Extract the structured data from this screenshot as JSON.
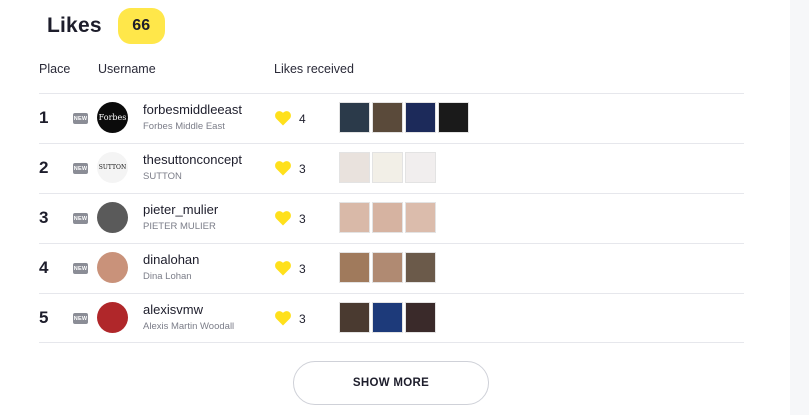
{
  "title": "Likes",
  "total_count": "66",
  "columns": {
    "place": "Place",
    "username": "Username",
    "likes_received": "Likes received"
  },
  "new_tag": "NEW",
  "rows": [
    {
      "place": "1",
      "username": "forbesmiddleeast",
      "full_name": "Forbes Middle East",
      "likes": "4",
      "avatar_text": "Forbes",
      "avatar_color": "#0b0b0b",
      "thumb_colors": [
        "#2b3a4a",
        "#5a4a3a",
        "#1c2a5a",
        "#1a1a1a"
      ]
    },
    {
      "place": "2",
      "username": "thesuttonconcept",
      "full_name": "SUTTON",
      "likes": "3",
      "avatar_text": "SUTTON",
      "avatar_color": "#f4f4f4",
      "thumb_colors": [
        "#e9e2dd",
        "#f2efe7",
        "#f1eeee"
      ]
    },
    {
      "place": "3",
      "username": "pieter_mulier",
      "full_name": "PIETER MULIER",
      "likes": "3",
      "avatar_text": "",
      "avatar_color": "#5a5a5a",
      "thumb_colors": [
        "#d9b9a8",
        "#d6b3a1",
        "#dbbcac"
      ]
    },
    {
      "place": "4",
      "username": "dinalohan",
      "full_name": "Dina Lohan",
      "likes": "3",
      "avatar_text": "",
      "avatar_color": "#c9927a",
      "thumb_colors": [
        "#a07a5c",
        "#b08a72",
        "#6b5a4a"
      ]
    },
    {
      "place": "5",
      "username": "alexisvmw",
      "full_name": "Alexis Martin Woodall",
      "likes": "3",
      "avatar_text": "",
      "avatar_color": "#b0272a",
      "thumb_colors": [
        "#4a3a30",
        "#1d3a7a",
        "#3a2a2a"
      ]
    }
  ],
  "show_more_label": "SHOW MORE",
  "colors": {
    "accent_yellow": "#ffe74a",
    "heart_yellow": "#ffe01b",
    "new_tag_gray": "#8b8d96",
    "divider": "#e6e7ec"
  }
}
